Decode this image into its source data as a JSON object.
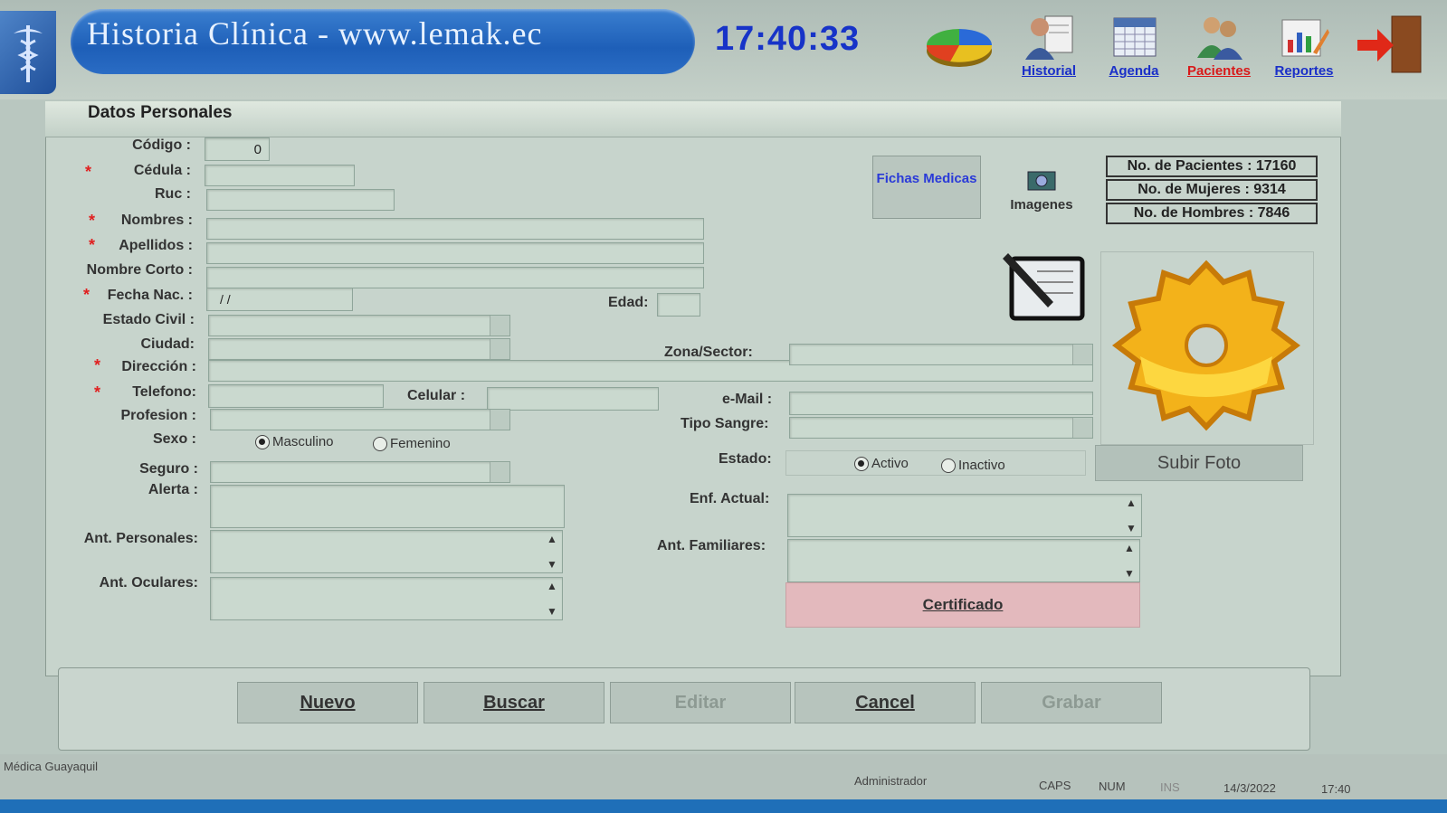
{
  "header": {
    "title": "Historia Clínica - www.lemak.ec",
    "clock": "17:40:33",
    "tools": [
      {
        "label": "Historial",
        "color": "#1a2fc8"
      },
      {
        "label": "Agenda",
        "color": "#1a2fc8"
      },
      {
        "label": "Pacientes",
        "color": "#d81a1a"
      },
      {
        "label": "Reportes",
        "color": "#1a2fc8"
      }
    ]
  },
  "panel": {
    "title": "Datos Personales",
    "labels": {
      "codigo": "Código :",
      "cedula": "Cédula :",
      "ruc": "Ruc :",
      "nombres": "Nombres :",
      "apellidos": "Apellidos :",
      "nombre_corto": "Nombre Corto :",
      "fecha_nac": "Fecha Nac. :",
      "edad": "Edad:",
      "estado_civil": "Estado Civil :",
      "ciudad": "Ciudad:",
      "zona": "Zona/Sector:",
      "direccion": "Dirección :",
      "telefono": "Telefono:",
      "celular": "Celular :",
      "email": "e-Mail :",
      "profesion": "Profesion :",
      "tipo_sangre": "Tipo Sangre:",
      "sexo": "Sexo :",
      "estado": "Estado:",
      "seguro": "Seguro :",
      "alerta": "Alerta :",
      "enf_actual": "Enf. Actual:",
      "ant_personales": "Ant. Personales:",
      "ant_familiares": "Ant. Familiares:",
      "ant_oculares": "Ant. Oculares:"
    },
    "required_mark": "*",
    "values": {
      "codigo": "0",
      "fecha_nac": "/ /"
    },
    "sexo_options": [
      "Masculino",
      "Femenino"
    ],
    "estado_options": [
      "Activo",
      "Inactivo"
    ],
    "fichas_label": "Fichas Medicas",
    "imagenes_label": "Imagenes",
    "stats": [
      "No. de Pacientes : 17160",
      "No. de Mujeres : 9314",
      "No. de Hombres : 7846"
    ],
    "subir_foto": "Subir Foto",
    "certificado": "Certificado"
  },
  "actions": [
    "Nuevo",
    "Buscar",
    "Editar",
    "Cancel",
    "Grabar"
  ],
  "status_bar": {
    "left": "Médica Guayaquil",
    "user": "Administrador",
    "caps": "CAPS",
    "num": "NUM",
    "ins": "INS",
    "date": "14/3/2022",
    "time": "17:40"
  },
  "colors": {
    "accent_blue": "#1e5fb8",
    "required_red": "#e02020",
    "certificado_bg": "#e3b9bd"
  }
}
